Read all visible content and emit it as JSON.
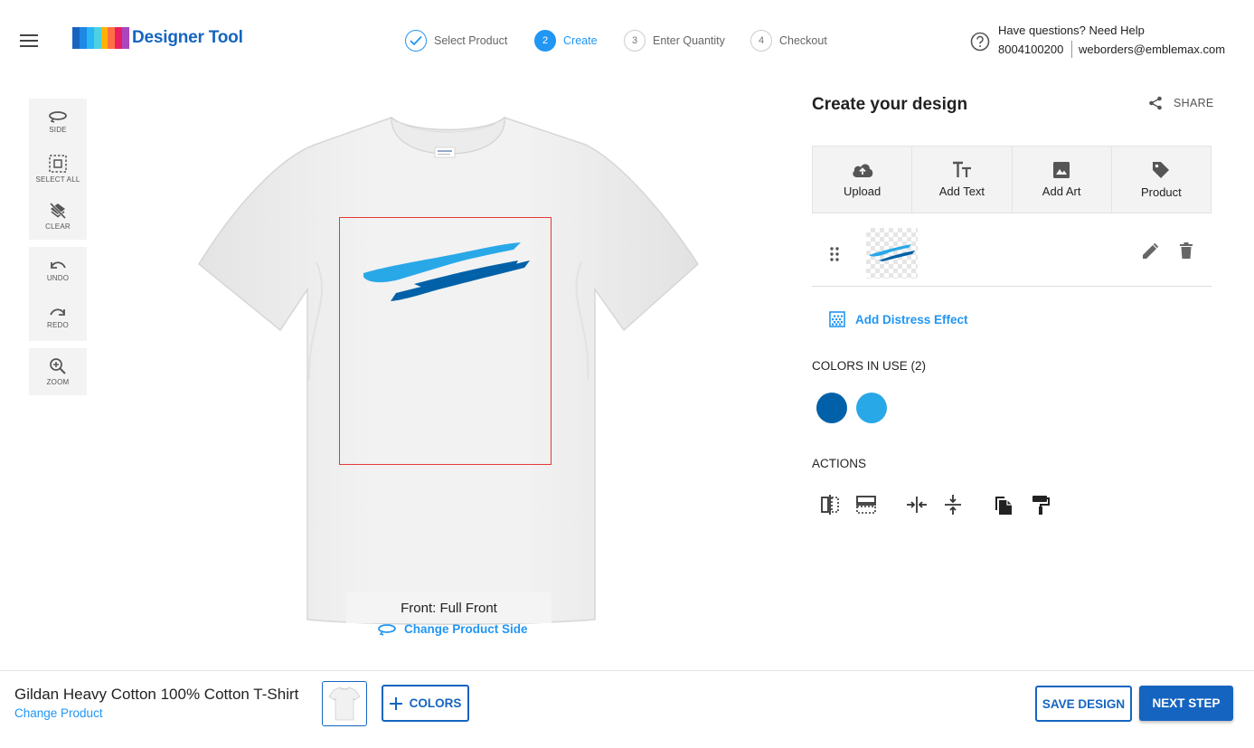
{
  "header": {
    "brand_name": "Designer Tool",
    "logo_colors": [
      "#1565c0",
      "#1e88e5",
      "#29b6f6",
      "#4dd0e1",
      "#ffb300",
      "#ff7043",
      "#e91e63",
      "#ab47bc"
    ],
    "steps": [
      {
        "number": "1",
        "label": "Select Product",
        "state": "done"
      },
      {
        "number": "2",
        "label": "Create",
        "state": "active"
      },
      {
        "number": "3",
        "label": "Enter Quantity",
        "state": "pending"
      },
      {
        "number": "4",
        "label": "Checkout",
        "state": "pending"
      }
    ],
    "help": {
      "title": "Have questions? Need Help",
      "phone": "8004100200",
      "email": "weborders@emblemax.com",
      "icon": "help-circle-icon"
    }
  },
  "toolbar": {
    "side_label": "SIDE",
    "select_all_label": "SELECT ALL",
    "clear_label": "CLEAR",
    "undo_label": "UNDO",
    "redo_label": "REDO",
    "zoom_label": "ZOOM"
  },
  "canvas": {
    "side_label": "Front: Full Front",
    "change_side_label": "Change Product Side",
    "print_area_color": "#e53935",
    "design_colors": [
      "#0061a8",
      "#29a8e8"
    ]
  },
  "panel": {
    "title": "Create your design",
    "share_label": "SHARE",
    "tabs": [
      {
        "label": "Upload",
        "icon": "cloud-upload-icon"
      },
      {
        "label": "Add Text",
        "icon": "text-size-icon"
      },
      {
        "label": "Add Art",
        "icon": "image-icon"
      },
      {
        "label": "Product",
        "icon": "tag-icon"
      }
    ],
    "distress_label": "Add Distress Effect",
    "colors_title": "COLORS IN USE (2)",
    "colors_in_use": [
      "#0061a8",
      "#29a8e8"
    ],
    "actions_title": "ACTIONS",
    "actions": [
      "flip-horizontal-icon",
      "flip-vertical-icon",
      "center-horizontal-icon",
      "center-vertical-icon",
      "duplicate-icon",
      "format-paint-icon"
    ]
  },
  "footer": {
    "product_name": "Gildan Heavy Cotton 100% Cotton T-Shirt",
    "change_product_label": "Change Product",
    "colors_button_label": "COLORS",
    "save_button_label": "SAVE DESIGN",
    "next_button_label": "NEXT STEP"
  }
}
